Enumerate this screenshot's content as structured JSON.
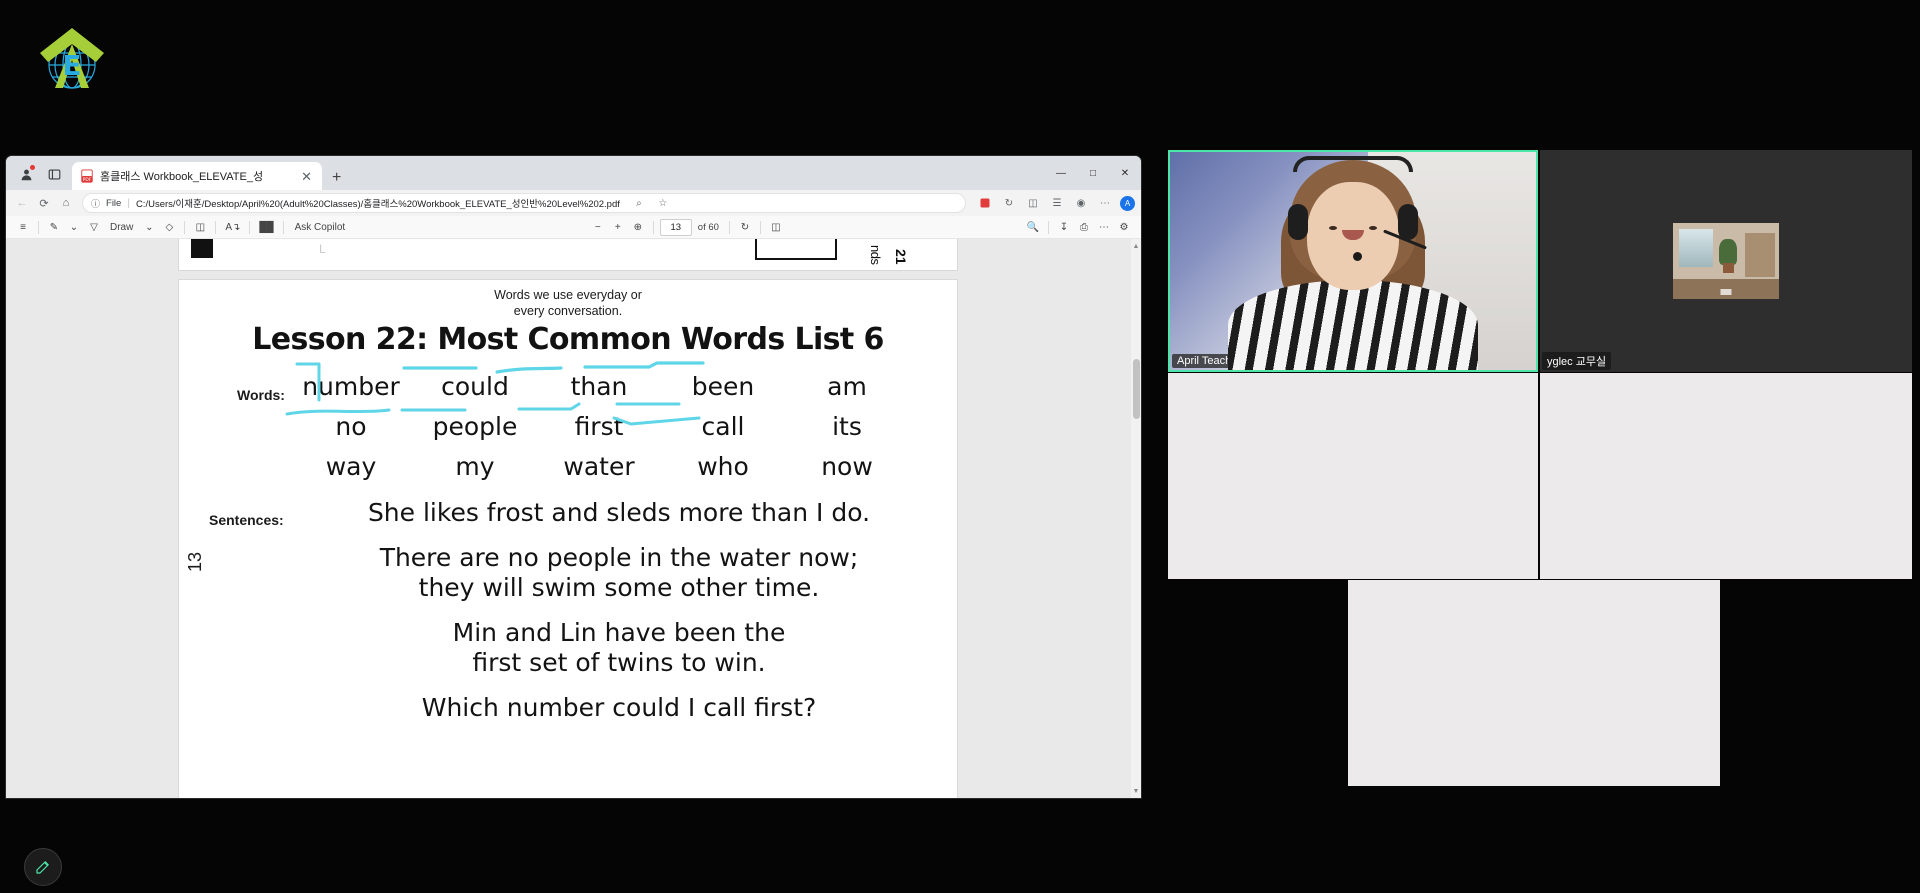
{
  "brand": {
    "logo_letter": "E",
    "logo_green": "#a6ce39",
    "logo_blue": "#29abe2"
  },
  "browser": {
    "profile_icon": "profile-icon",
    "tabs_icon": "tab-search-icon",
    "tab": {
      "favicon": "pdf-file-icon",
      "title": "홈클래스 Workbook_ELEVATE_성",
      "close": "✕"
    },
    "new_tab": "+",
    "window_controls": {
      "minimize": "—",
      "maximize": "□",
      "close": "✕"
    },
    "nav": {
      "back": "←",
      "forward": "→",
      "reload": "⟳",
      "home": "⌂"
    },
    "omnibox": {
      "info_icon": "info-circle-icon",
      "file_label": "File",
      "separator": "|",
      "url": "C:/Users/이재훈/Desktop/April%20(Adult%20Classes)/홈클래스%20Workbook_ELEVATE_성인반%20Level%202.pdf",
      "zoom_icon": "search-zoom-icon",
      "favorite_icon": "star-icon",
      "ext_pdf_icon": "pdf-extension-icon",
      "ext_history_icon": "history-icon",
      "ext_split_icon": "split-screen-icon",
      "ext_collections_icon": "collections-icon",
      "ext_browser_icon": "browser-essentials-icon",
      "more_icon": "more-settings-icon",
      "avatar": "A"
    },
    "pdf_toolbar": {
      "toc": "table-of-contents-icon",
      "highlight": "highlight-icon",
      "highlight_caret": "chevron-down-icon",
      "draw_icon": "pen-icon",
      "draw_label": "Draw",
      "draw_caret": "chevron-down-icon",
      "erase": "eraser-icon",
      "read_aloud_layout": "page-layout-icon",
      "read_aloud": "read-aloud-icon",
      "text_style": "text-style-icon",
      "copilot_label": "Ask Copilot",
      "zoom_out": "−",
      "zoom_in": "+",
      "fit_page": "fit-to-page-icon",
      "page_current": "13",
      "page_of": "of 60",
      "rotate": "rotate-icon",
      "view_mode": "two-page-view-icon",
      "search": "search-icon",
      "save": "save-icon",
      "print": "print-icon",
      "more": "more-options-icon",
      "settings": "settings-gear-icon"
    }
  },
  "pdf_page": {
    "note_line1": "Words we use everyday or",
    "note_line2": "every conversation.",
    "title": "Lesson 22: Most Common Words List 6",
    "words_label": "Words:",
    "sentences_label": "Sentences:",
    "page_number": "13",
    "words": [
      "number",
      "could",
      "than",
      "been",
      "am",
      "no",
      "people",
      "first",
      "call",
      "its",
      "way",
      "my",
      "water",
      "who",
      "now"
    ],
    "sentences": [
      "She likes frost and sleds more than I do.",
      "There are no people in the water now;\nthey will swim some other time.",
      "Min and Lin have been the\nfirst set of twins to win.",
      "Which number could I call first?"
    ],
    "prev_page_marks": {
      "vertical_text": "nds",
      "page_badge": "21"
    },
    "annotation_color": "#5fd6e8"
  },
  "video_conference": {
    "tiles": [
      {
        "name": "April Teacher",
        "kind": "webcam-person",
        "active": true
      },
      {
        "name": "yglec 교무실",
        "kind": "webcam-room",
        "active": false
      },
      {
        "name": "",
        "kind": "blank",
        "active": false
      },
      {
        "name": "",
        "kind": "blank",
        "active": false
      },
      {
        "name": "",
        "kind": "blank",
        "active": false
      }
    ],
    "active_border_color": "#4ee6a8"
  },
  "floating_button": {
    "icon": "pencil-annotate-icon"
  }
}
